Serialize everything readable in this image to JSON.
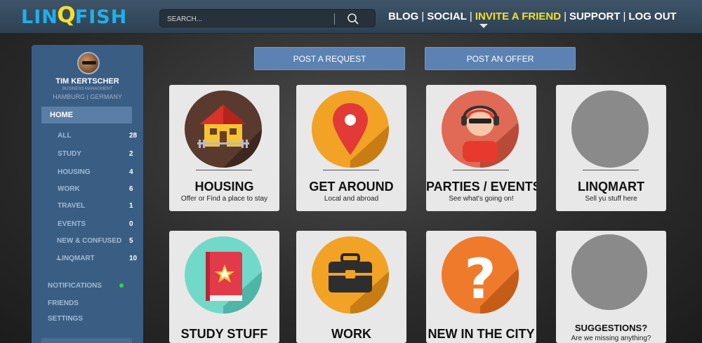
{
  "header": {
    "logo_left": "LIN",
    "logo_q": "Q",
    "logo_right": "FISH",
    "search_placeholder": "SEARCH...",
    "nav": [
      "BLOG",
      "SOCIAL",
      "INVITE A FRIEND",
      "SUPPORT",
      "LOG OUT"
    ],
    "nav_active_index": 2,
    "accent": "#f3df2d",
    "logo_color": "#1fb0ea"
  },
  "sidebar": {
    "user_name": "TIM KERTSCHER",
    "user_role": "BUSINESS MANAGMENT",
    "user_location": "HAMBURG | GERMANY",
    "home": "HOME",
    "categories": [
      {
        "label": "ALL",
        "count": "28"
      },
      {
        "label": "STUDY",
        "count": "2"
      },
      {
        "label": "HOUSING",
        "count": "4"
      },
      {
        "label": "WORK",
        "count": "6"
      },
      {
        "label": "TRAVEL",
        "count": "1"
      },
      {
        "label": "EVENTS",
        "count": "0"
      },
      {
        "label": "NEW & CONFUSED",
        "count": "5"
      },
      {
        "label": "LINQMART",
        "count": "10"
      }
    ],
    "notifications": "NOTIFICATIONS",
    "friends": "FRIENDS",
    "settings": "SETTINGS",
    "notification_status_color": "#34d14a"
  },
  "actions": {
    "post_request": "POST A REQUEST",
    "post_offer": "POST AN OFFER"
  },
  "cards": [
    {
      "title": "HOUSING",
      "desc": "Offer or Find a place to stay",
      "icon": "house-icon",
      "color": "#5a3a2e"
    },
    {
      "title": "GET AROUND",
      "desc": "Local and abroad",
      "icon": "map-pin-icon",
      "color": "#f2a325"
    },
    {
      "title": "PARTIES / EVENTS",
      "desc": "See what's going on!",
      "icon": "dj-icon",
      "color": "#e06a55"
    },
    {
      "title": "LINQMART",
      "desc": "Sell yu stuff here",
      "icon": "placeholder-icon",
      "color": "#8a8a8a"
    },
    {
      "title": "STUDY STUFF",
      "desc": "",
      "icon": "book-icon",
      "color": "#72d9c9"
    },
    {
      "title": "WORK",
      "desc": "",
      "icon": "briefcase-icon",
      "color": "#f2a325"
    },
    {
      "title": "NEW IN THE CITY",
      "desc": "",
      "icon": "question-icon",
      "color": "#f07a2c"
    },
    {
      "title": "SUGGESTIONS?",
      "desc": "Are we missing anything?",
      "icon": "placeholder-icon",
      "color": "#8a8a8a"
    }
  ]
}
